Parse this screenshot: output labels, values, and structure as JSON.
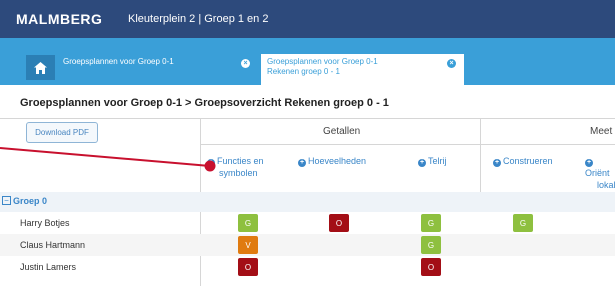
{
  "header": {
    "logo": "MALMBERG",
    "context": "Kleuterplein 2  |  Groep 1 en 2"
  },
  "tabs": [
    {
      "label": "Groepsplannen voor Groep 0-1",
      "active": false
    },
    {
      "label_line1": "Groepsplannen voor Groep 0-1",
      "label_line2": "Rekenen groep 0 - 1",
      "active": true
    }
  ],
  "breadcrumb": "Groepsplannen voor Groep 0-1 > Groepsoverzicht Rekenen groep 0 - 1",
  "toolbar": {
    "download_pdf": "Download PDF"
  },
  "column_groups": [
    "Getallen",
    "Meet"
  ],
  "columns": [
    {
      "line1": "Functies en",
      "line2": "symbolen"
    },
    {
      "line1": "Hoeveelheden"
    },
    {
      "line1": "Telrij"
    },
    {
      "line1": "Construeren"
    },
    {
      "line1": "Oriënt",
      "line2": "lokali"
    }
  ],
  "group": {
    "label": "Groep 0",
    "toggle": "−"
  },
  "students": [
    {
      "name": "Harry Botjes",
      "scores": [
        "G",
        "O",
        "G",
        "G",
        ""
      ]
    },
    {
      "name": "Claus Hartmann",
      "scores": [
        "V",
        "",
        "G",
        "",
        ""
      ]
    },
    {
      "name": "Justin Lamers",
      "scores": [
        "O",
        "",
        "O",
        "",
        ""
      ]
    }
  ],
  "colors": {
    "G": "#8ec03f",
    "O": "#a30e16",
    "V": "#e07b10",
    "accent": "#3a9fd8",
    "topbar": "#2d4a7c",
    "pointer": "#c8102e"
  }
}
